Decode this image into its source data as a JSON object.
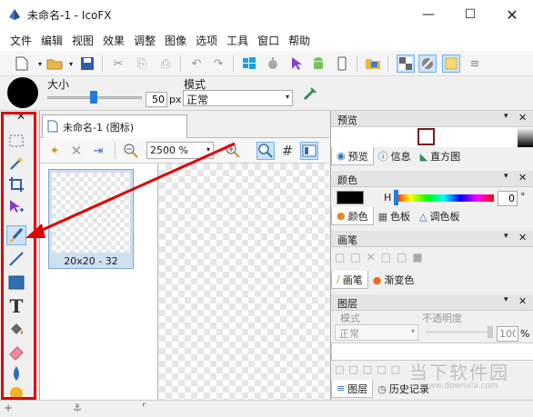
{
  "window": {
    "title": "未命名-1 - IcoFX",
    "minimize_icon": "minimize-icon",
    "maximize_icon": "maximize-icon",
    "close_icon": "close-icon"
  },
  "menu": [
    "文件",
    "编辑",
    "视图",
    "效果",
    "调整",
    "图像",
    "选项",
    "工具",
    "窗口",
    "帮助"
  ],
  "options_bar": {
    "size_label": "大小",
    "size_value": "50",
    "size_unit": "px",
    "mode_label": "模式",
    "mode_value": "正常"
  },
  "document": {
    "tab_title": "未命名-1 (图标)",
    "zoom_value": "2500 %",
    "thumbnail_label": "20x20 - 32"
  },
  "panels": {
    "preview": {
      "title": "预览",
      "tabs": [
        "预览",
        "信息",
        "直方图"
      ]
    },
    "color": {
      "title": "颜色",
      "h_label": "H",
      "h_value": "0",
      "h_unit": "°",
      "tabs": [
        "颜色",
        "色板",
        "调色板"
      ]
    },
    "brush": {
      "title": "画笔",
      "tabs": [
        "画笔",
        "渐变色"
      ]
    },
    "layers": {
      "title": "图层",
      "mode_label": "模式",
      "opacity_label": "不透明度",
      "mode_value": "正常",
      "opacity_value": "100",
      "opacity_unit": "%",
      "tabs": [
        "图层",
        "历史记录"
      ]
    }
  },
  "watermark": {
    "text_cn": "当下软件园",
    "text_en": "www.downxia.com"
  },
  "colors": {
    "annotation": "#e00000",
    "selection": "#cfe0f3",
    "accent": "#2f6fb5"
  }
}
